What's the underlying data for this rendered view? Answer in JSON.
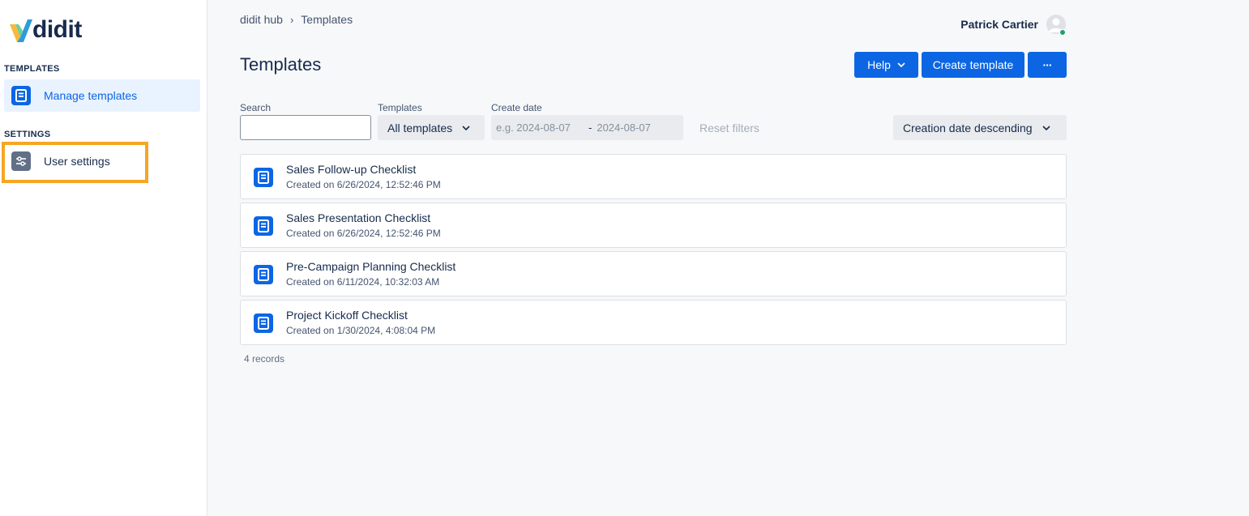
{
  "brand": {
    "name": "didit"
  },
  "sidebar": {
    "sections": [
      {
        "title": "TEMPLATES",
        "items": [
          {
            "label": "Manage templates",
            "icon": "document-icon"
          }
        ]
      },
      {
        "title": "SETTINGS",
        "items": [
          {
            "label": "User settings",
            "icon": "sliders-icon"
          }
        ]
      }
    ]
  },
  "breadcrumb": {
    "items": [
      "didit hub",
      "Templates"
    ],
    "separator": "›"
  },
  "user": {
    "name": "Patrick Cartier",
    "status": "online"
  },
  "page": {
    "title": "Templates"
  },
  "actions": {
    "help_label": "Help",
    "create_label": "Create template",
    "more_label": "···"
  },
  "filters": {
    "search_label": "Search",
    "search_value": "",
    "templates_label": "Templates",
    "templates_value": "All templates",
    "date_label": "Create date",
    "date_start_placeholder": "e.g. 2024-08-07",
    "date_separator": "-",
    "date_end_placeholder": "2024-08-07",
    "reset_label": "Reset filters",
    "sort_value": "Creation date descending"
  },
  "templates": [
    {
      "title": "Sales Follow-up Checklist",
      "created": "Created on 6/26/2024, 12:52:46 PM"
    },
    {
      "title": "Sales Presentation Checklist",
      "created": "Created on 6/26/2024, 12:52:46 PM"
    },
    {
      "title": "Pre-Campaign Planning Checklist",
      "created": "Created on 6/11/2024, 10:32:03 AM"
    },
    {
      "title": "Project Kickoff Checklist",
      "created": "Created on 1/30/2024, 4:08:04 PM"
    }
  ],
  "records_text": "4 records",
  "colors": {
    "primary": "#0c66e4",
    "highlight": "#f5a623",
    "text": "#172b4d"
  }
}
